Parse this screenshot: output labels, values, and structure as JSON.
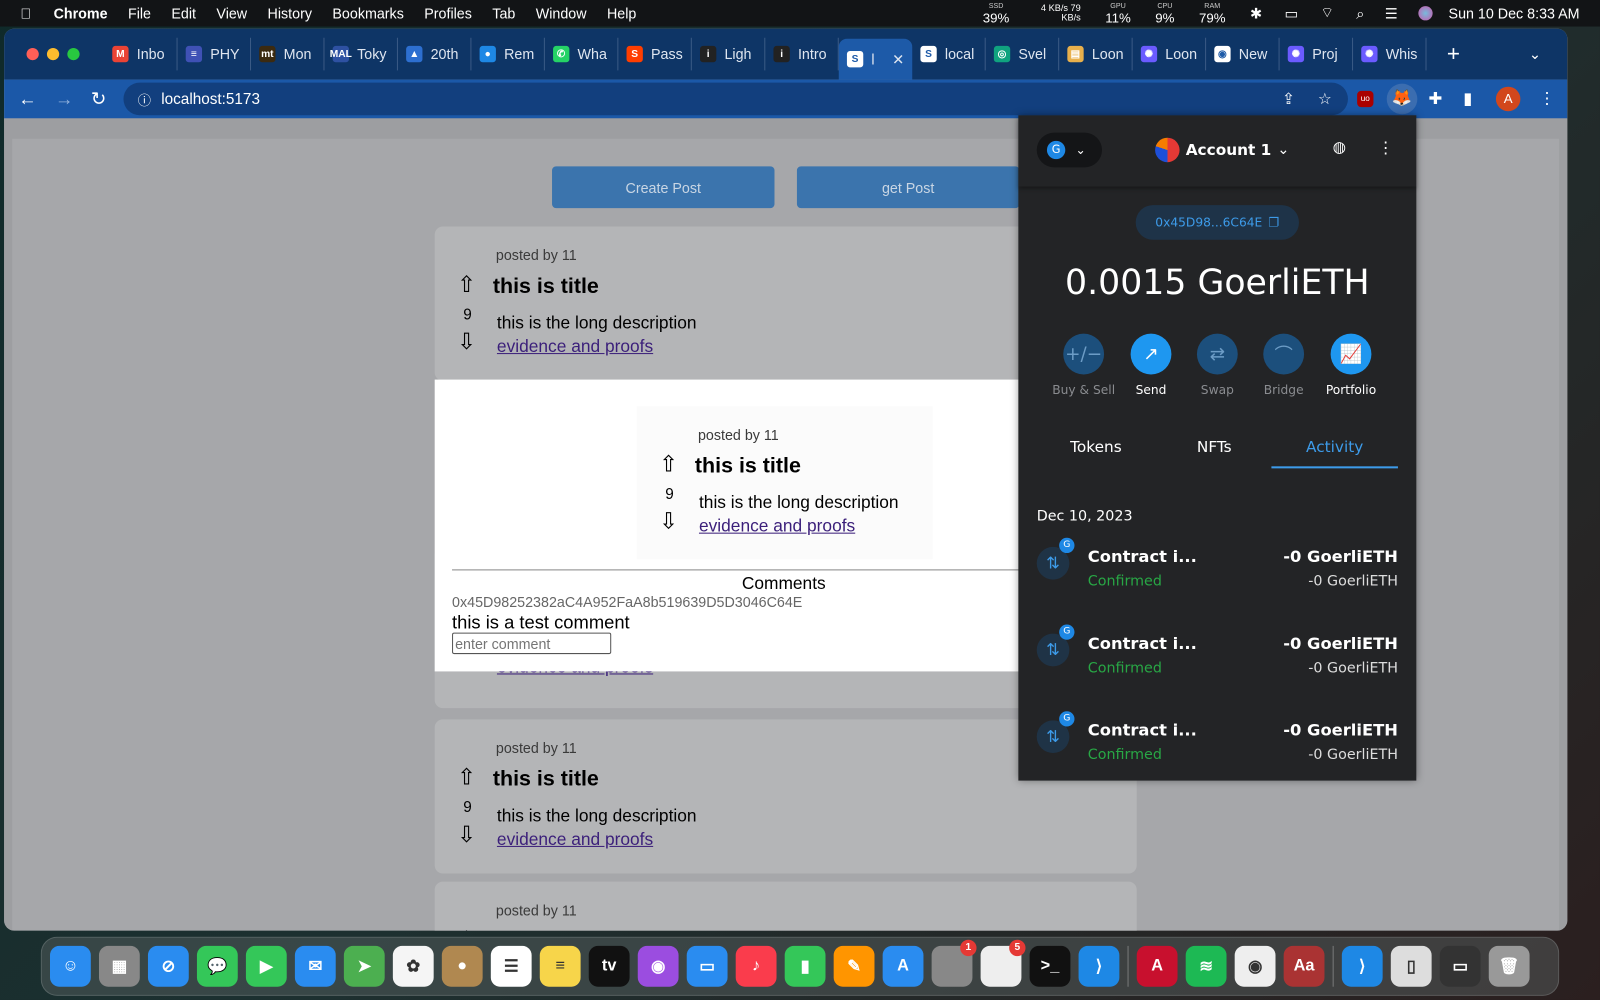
{
  "menubar": {
    "app": "Chrome",
    "items": [
      "File",
      "Edit",
      "View",
      "History",
      "Bookmarks",
      "Profiles",
      "Tab",
      "Window",
      "Help"
    ],
    "stats": [
      {
        "label": "SSD",
        "value": "39%"
      },
      {
        "label": "",
        "value": "4 KB/s 79 KB/s"
      },
      {
        "label": "GPU",
        "value": "11%"
      },
      {
        "label": "CPU",
        "value": "9%"
      },
      {
        "label": "RAM",
        "value": "79%"
      }
    ],
    "datetime": "Sun 10 Dec  8:33 AM"
  },
  "tabs": [
    {
      "label": "Inbo",
      "color": "#ea4335",
      "icon": "M"
    },
    {
      "label": "PHY",
      "color": "#3f51b5",
      "icon": "≡"
    },
    {
      "label": "Mon",
      "color": "#3b2a10",
      "icon": "mt"
    },
    {
      "label": "Toky",
      "color": "#2e51a2",
      "icon": "MAL"
    },
    {
      "label": "20th",
      "color": "#2d6fd0",
      "icon": "▲"
    },
    {
      "label": "Rem",
      "color": "#1e88e5",
      "icon": "●"
    },
    {
      "label": "Wha",
      "color": "#25d366",
      "icon": "✆"
    },
    {
      "label": "Pass",
      "color": "#ff3e00",
      "icon": "S"
    },
    {
      "label": "Ligh",
      "color": "#222",
      "icon": "i"
    },
    {
      "label": "Intro",
      "color": "#222",
      "icon": "i"
    },
    {
      "label": "l",
      "color": "#ffffff",
      "icon": "S",
      "active": true
    },
    {
      "label": "local",
      "color": "#ffffff",
      "icon": "S"
    },
    {
      "label": "Svel",
      "color": "#10a37f",
      "icon": "◎"
    },
    {
      "label": "Loon",
      "color": "#e8b04c",
      "icon": "▤"
    },
    {
      "label": "Loon",
      "color": "#6b5bff",
      "icon": "✺"
    },
    {
      "label": "New",
      "color": "#ffffff",
      "icon": "◉"
    },
    {
      "label": "Proj",
      "color": "#6b5bff",
      "icon": "✺"
    },
    {
      "label": "Whis",
      "color": "#6b5bff",
      "icon": "✺"
    }
  ],
  "toolbar": {
    "url": "localhost:5173",
    "avatar": "A"
  },
  "page": {
    "create_label": "Create Post",
    "get_label": "get Post",
    "post": {
      "posted_by": "posted by 11",
      "title": "this is title",
      "votes": "9",
      "description": "this is the long description",
      "link": "evidence and proofs"
    },
    "comments": {
      "heading": "Comments",
      "author": "0x45D98252382aC4A952FaA8b519639D5D3046C64E",
      "text": "this is a test comment",
      "placeholder": "enter comment"
    }
  },
  "metamask": {
    "network": "G",
    "account": "Account 1",
    "address": "0x45D98...6C64E",
    "balance": "0.0015 GoerliETH",
    "actions": [
      {
        "label": "Buy & Sell",
        "icon": "+/−",
        "enabled": false
      },
      {
        "label": "Send",
        "icon": "↗",
        "enabled": true
      },
      {
        "label": "Swap",
        "icon": "⇄",
        "enabled": false
      },
      {
        "label": "Bridge",
        "icon": "⌒",
        "enabled": false
      },
      {
        "label": "Portfolio",
        "icon": "📈",
        "enabled": true
      }
    ],
    "tabs": [
      "Tokens",
      "NFTs",
      "Activity"
    ],
    "active_tab": "Activity",
    "date": "Dec 10, 2023",
    "transactions": [
      {
        "title": "Contract i...",
        "status": "Confirmed",
        "amount": "-0 GoerliETH",
        "fiat": "-0 GoerliETH"
      },
      {
        "title": "Contract i...",
        "status": "Confirmed",
        "amount": "-0 GoerliETH",
        "fiat": "-0 GoerliETH"
      },
      {
        "title": "Contract i...",
        "status": "Confirmed",
        "amount": "-0 GoerliETH",
        "fiat": "-0 GoerliETH"
      }
    ]
  },
  "dock": [
    {
      "name": "finder",
      "color": "#2a8cf0",
      "g": "☺"
    },
    {
      "name": "launchpad",
      "color": "#888",
      "g": "▦"
    },
    {
      "name": "safari",
      "color": "#2a8cf0",
      "g": "⊘"
    },
    {
      "name": "messages",
      "color": "#34c759",
      "g": "💬"
    },
    {
      "name": "facetime",
      "color": "#34c759",
      "g": "▶"
    },
    {
      "name": "mail",
      "color": "#2a8cf0",
      "g": "✉"
    },
    {
      "name": "maps",
      "color": "#4caf50",
      "g": "➤"
    },
    {
      "name": "photos",
      "color": "#f5f5f5",
      "g": "✿"
    },
    {
      "name": "contacts",
      "color": "#b08850",
      "g": "●"
    },
    {
      "name": "reminders",
      "color": "#fff",
      "g": "☰"
    },
    {
      "name": "notes",
      "color": "#f7d54a",
      "g": "≡"
    },
    {
      "name": "tv",
      "color": "#111",
      "g": "tv"
    },
    {
      "name": "podcasts",
      "color": "#9b4de0",
      "g": "◉"
    },
    {
      "name": "keynote",
      "color": "#2a8cf0",
      "g": "▭"
    },
    {
      "name": "music",
      "color": "#fa3c4c",
      "g": "♪"
    },
    {
      "name": "numbers",
      "color": "#34c759",
      "g": "▮"
    },
    {
      "name": "pages",
      "color": "#ff9500",
      "g": "✎"
    },
    {
      "name": "app-store",
      "color": "#2a8cf0",
      "g": "A"
    },
    {
      "name": "system-settings",
      "color": "#888",
      "g": "⚙",
      "badge": "1"
    },
    {
      "name": "microsoft",
      "color": "#eee",
      "g": "▦",
      "badge": "5"
    },
    {
      "name": "terminal",
      "color": "#111",
      "g": ">_"
    },
    {
      "name": "vscode",
      "color": "#1e88e5",
      "g": "⟩"
    },
    {
      "name": "autocad",
      "color": "#c8102e",
      "g": "A"
    },
    {
      "name": "spotify",
      "color": "#1db954",
      "g": "≋"
    },
    {
      "name": "chrome",
      "color": "#eee",
      "g": "◉"
    },
    {
      "name": "dictionary",
      "color": "#a33",
      "g": "Aa"
    },
    {
      "name": "vscode-2",
      "color": "#1e88e5",
      "g": "⟩"
    },
    {
      "name": "html-file",
      "color": "#ddd",
      "g": "▯"
    },
    {
      "name": "folder",
      "color": "#333",
      "g": "▭"
    },
    {
      "name": "trash",
      "color": "#999",
      "g": "🗑"
    }
  ]
}
